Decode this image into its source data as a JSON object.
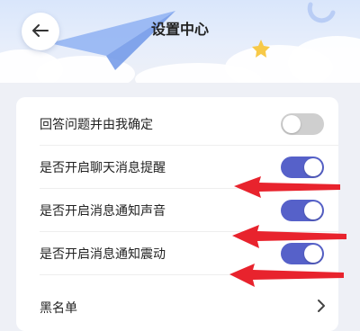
{
  "header": {
    "title": "设置中心"
  },
  "settings": [
    {
      "label": "回答问题并由我确定",
      "type": "toggle",
      "on": false
    },
    {
      "label": "是否开启聊天消息提醒",
      "type": "toggle",
      "on": true
    },
    {
      "label": "是否开启消息通知声音",
      "type": "toggle",
      "on": true
    },
    {
      "label": "是否开启消息通知震动",
      "type": "toggle",
      "on": true
    },
    {
      "label": "黑名单",
      "type": "link"
    }
  ],
  "colors": {
    "accent": "#5661c9",
    "switch_off": "#cfcfcf",
    "arrow": "#e8232d"
  },
  "icons": {
    "back": "arrow-left-icon",
    "chevron": "chevron-right-icon"
  }
}
